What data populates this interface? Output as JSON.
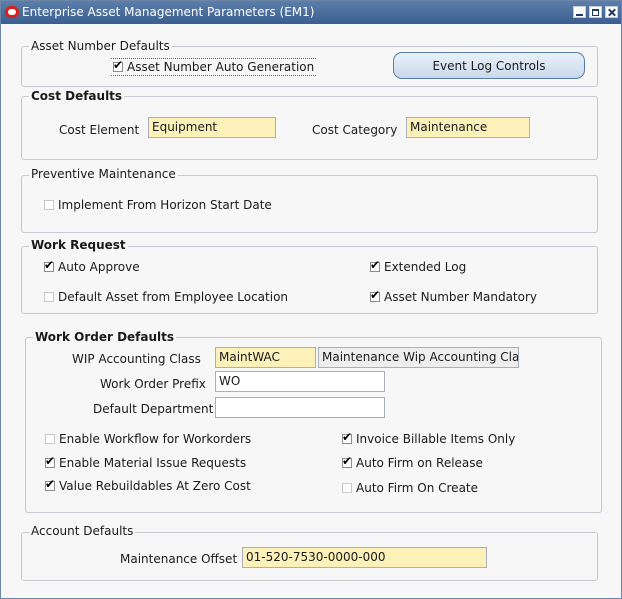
{
  "window": {
    "title": "Enterprise Asset Management Parameters (EM1)"
  },
  "asset_number_defaults": {
    "label": "Asset Number Defaults",
    "auto_generation": {
      "label": "Asset Number Auto Generation",
      "checked": true
    },
    "event_log_button": "Event Log Controls"
  },
  "cost_defaults": {
    "label": "Cost Defaults",
    "cost_element": {
      "label": "Cost Element",
      "value": "Equipment"
    },
    "cost_category": {
      "label": "Cost Category",
      "value": "Maintenance"
    }
  },
  "preventive_maintenance": {
    "label": "Preventive Maintenance",
    "implement_from_horizon": {
      "label": "Implement From Horizon Start Date",
      "checked": false
    }
  },
  "work_request": {
    "label": "Work Request",
    "auto_approve": {
      "label": "Auto Approve",
      "checked": true
    },
    "extended_log": {
      "label": "Extended Log",
      "checked": true
    },
    "default_asset": {
      "label": "Default Asset from Employee Location",
      "checked": false
    },
    "asset_number_mandatory": {
      "label": "Asset Number Mandatory",
      "checked": true
    }
  },
  "work_order_defaults": {
    "label": "Work Order Defaults",
    "wip_accounting_class": {
      "label": "WIP Accounting Class",
      "value": "MaintWAC",
      "description": "Maintenance Wip Accounting Clas"
    },
    "work_order_prefix": {
      "label": "Work Order Prefix",
      "value": "WO"
    },
    "default_department": {
      "label": "Default Department",
      "value": ""
    },
    "enable_workflow": {
      "label": "Enable Workflow for Workorders",
      "checked": false
    },
    "invoice_billable": {
      "label": "Invoice Billable Items Only",
      "checked": true
    },
    "enable_material_issue": {
      "label": "Enable Material Issue Requests",
      "checked": true
    },
    "auto_firm_release": {
      "label": "Auto Firm on Release",
      "checked": true
    },
    "value_rebuildables": {
      "label": "Value Rebuildables At Zero Cost",
      "checked": true
    },
    "auto_firm_create": {
      "label": "Auto Firm On Create",
      "checked": false
    }
  },
  "account_defaults": {
    "label": "Account Defaults",
    "maintenance_offset": {
      "label": "Maintenance Offset",
      "value": "01-520-7530-0000-000"
    }
  },
  "colors": {
    "required_field": "#fcf1b9",
    "title_bar": "#3a5f8f",
    "button": "#c9d9ec"
  }
}
